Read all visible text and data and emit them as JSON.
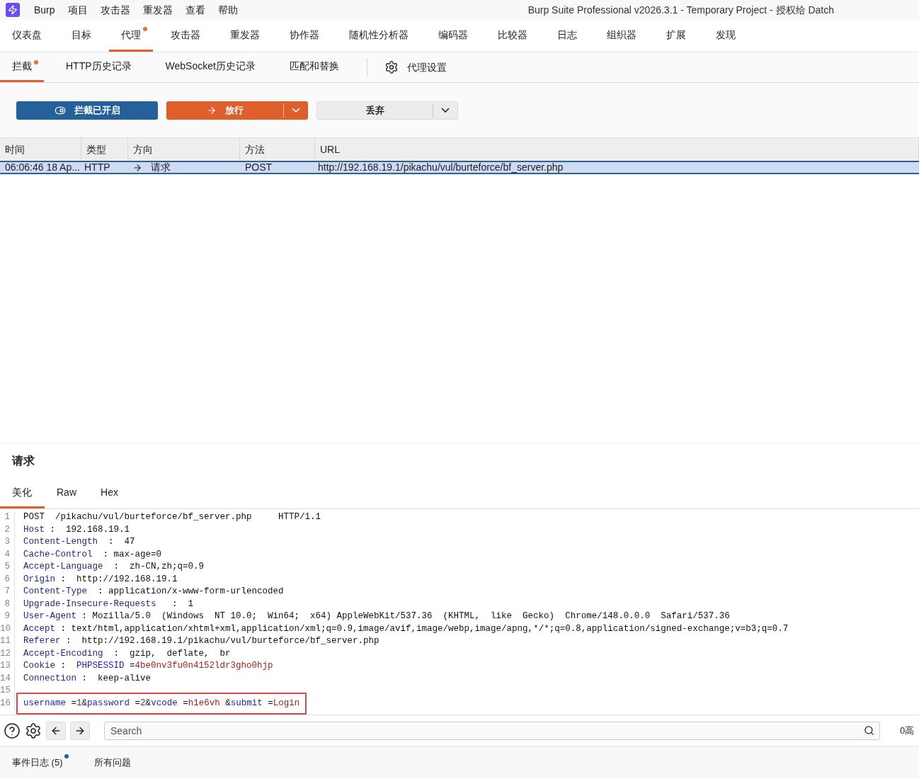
{
  "menu_bar": {
    "items": [
      "Burp",
      "项目",
      "攻击器",
      "重发器",
      "查看",
      "帮助"
    ],
    "title": "Burp Suite Professional v2026.3.1 - Temporary Project - 授权给 Datch"
  },
  "main_tabs": [
    {
      "label": "仪表盘",
      "selected": false,
      "dot": false
    },
    {
      "label": "目标",
      "selected": false,
      "dot": false
    },
    {
      "label": "代理",
      "selected": true,
      "dot": true
    },
    {
      "label": "攻击器",
      "selected": false,
      "dot": false
    },
    {
      "label": "重发器",
      "selected": false,
      "dot": false
    },
    {
      "label": "协作器",
      "selected": false,
      "dot": false
    },
    {
      "label": "随机性分析器",
      "selected": false,
      "dot": false
    },
    {
      "label": "编码器",
      "selected": false,
      "dot": false
    },
    {
      "label": "比较器",
      "selected": false,
      "dot": false
    },
    {
      "label": "日志",
      "selected": false,
      "dot": false
    },
    {
      "label": "组织器",
      "selected": false,
      "dot": false
    },
    {
      "label": "扩展",
      "selected": false,
      "dot": false
    },
    {
      "label": "发现",
      "selected": false,
      "dot": false
    }
  ],
  "sub_tabs": [
    {
      "label": "拦截",
      "selected": true,
      "dot": true
    },
    {
      "label": "HTTP历史记录",
      "selected": false,
      "dot": false
    },
    {
      "label": "WebSocket历史记录",
      "selected": false,
      "dot": false
    },
    {
      "label": "匹配和替换",
      "selected": false,
      "dot": false
    }
  ],
  "settings_tab": "代理设置",
  "toolbar": {
    "intercept": {
      "label": "拦截已开启",
      "on": true
    },
    "forward": "放行",
    "drop": "丢弃"
  },
  "table": {
    "columns": [
      "时间",
      "类型",
      "方向",
      "方法",
      "URL"
    ],
    "rows": [
      {
        "time": "06:06:46 18 Ap...",
        "type": "HTTP",
        "direction": "请求",
        "method": "POST",
        "url": "http://192.168.19.1/pikachu/vul/burteforce/bf_server.php",
        "selected": true
      }
    ]
  },
  "request": {
    "title": "请求",
    "tabs": [
      {
        "label": "美化",
        "selected": true
      },
      {
        "label": "Raw",
        "selected": false
      },
      {
        "label": "Hex",
        "selected": false
      }
    ],
    "lines": [
      {
        "number": "1",
        "highlighted": false,
        "tokens": [
          {
            "kind": "plain",
            "text": "POST  /pikachu/vul/burteforce/bf_server.php     HTTP/1.1"
          }
        ]
      },
      {
        "number": "2",
        "highlighted": false,
        "tokens": [
          {
            "kind": "key",
            "text": "Host"
          },
          {
            "kind": "plain",
            "text": " :  192.168.19.1"
          }
        ]
      },
      {
        "number": "3",
        "highlighted": false,
        "tokens": [
          {
            "kind": "key",
            "text": "Content-Length"
          },
          {
            "kind": "plain",
            "text": "  :  47"
          }
        ]
      },
      {
        "number": "4",
        "highlighted": false,
        "tokens": [
          {
            "kind": "key",
            "text": "Cache-Control"
          },
          {
            "kind": "plain",
            "text": "  : max-age=0"
          }
        ]
      },
      {
        "number": "5",
        "highlighted": false,
        "tokens": [
          {
            "kind": "key",
            "text": "Accept-Language"
          },
          {
            "kind": "plain",
            "text": "  :  zh-CN,zh;q=0.9"
          }
        ]
      },
      {
        "number": "6",
        "highlighted": false,
        "tokens": [
          {
            "kind": "key",
            "text": "Origin"
          },
          {
            "kind": "plain",
            "text": " :  http://192.168.19.1"
          }
        ]
      },
      {
        "number": "7",
        "highlighted": false,
        "tokens": [
          {
            "kind": "key",
            "text": "Content-Type"
          },
          {
            "kind": "plain",
            "text": "  : application/x-www-form-urlencoded"
          }
        ]
      },
      {
        "number": "8",
        "highlighted": false,
        "tokens": [
          {
            "kind": "key",
            "text": "Upgrade-Insecure-Requests"
          },
          {
            "kind": "plain",
            "text": "   :  1"
          }
        ]
      },
      {
        "number": "9",
        "highlighted": false,
        "tokens": [
          {
            "kind": "key",
            "text": "User-Agent"
          },
          {
            "kind": "plain",
            "text": " : Mozilla/5.0  (Windows  NT 10.0;  Win64;  x64) AppleWebKit/537.36  (KHTML,  like  Gecko)  Chrome/148.0.0.0  Safari/537.36"
          }
        ]
      },
      {
        "number": "10",
        "highlighted": false,
        "tokens": [
          {
            "kind": "key",
            "text": "Accept"
          },
          {
            "kind": "plain",
            "text": " : text/html,application/xhtml+xml,application/xml;q=0.9,image/avif,image/webp,image/apng,*/*;q=0.8,application/signed-exchange;v=b3;q=0.7"
          }
        ]
      },
      {
        "number": "11",
        "highlighted": false,
        "tokens": [
          {
            "kind": "key",
            "text": "Referer"
          },
          {
            "kind": "plain",
            "text": " :  http://192.168.19.1/pikachu/vul/burteforce/bf_server.php"
          }
        ]
      },
      {
        "number": "12",
        "highlighted": false,
        "tokens": [
          {
            "kind": "key",
            "text": "Accept-Encoding"
          },
          {
            "kind": "plain",
            "text": "  :  gzip,  deflate,  br"
          }
        ]
      },
      {
        "number": "13",
        "highlighted": false,
        "tokens": [
          {
            "kind": "key",
            "text": "Cookie"
          },
          {
            "kind": "plain",
            "text": " :  "
          },
          {
            "kind": "param",
            "text": "PHPSESSID"
          },
          {
            "kind": "plain",
            "text": " ="
          },
          {
            "kind": "value",
            "text": "4be0nv3fu0n4152ldr3gho0hjp"
          }
        ]
      },
      {
        "number": "14",
        "highlighted": false,
        "tokens": [
          {
            "kind": "key",
            "text": "Connection"
          },
          {
            "kind": "plain",
            "text": " :  keep-alive"
          }
        ]
      },
      {
        "number": "15"
      },
      {
        "number": "16",
        "highlighted": true,
        "tokens": [
          {
            "kind": "param",
            "text": "username"
          },
          {
            "kind": "plain",
            "text": " ="
          },
          {
            "kind": "value",
            "text": "1"
          },
          {
            "kind": "plain",
            "text": "&"
          },
          {
            "kind": "param",
            "text": "password"
          },
          {
            "kind": "plain",
            "text": " ="
          },
          {
            "kind": "value",
            "text": "2"
          },
          {
            "kind": "plain",
            "text": "&"
          },
          {
            "kind": "param",
            "text": "vcode"
          },
          {
            "kind": "plain",
            "text": " ="
          },
          {
            "kind": "value",
            "text": "h1e6vh"
          },
          {
            "kind": "plain",
            "text": " &"
          },
          {
            "kind": "param",
            "text": "submit"
          },
          {
            "kind": "plain",
            "text": " ="
          },
          {
            "kind": "value",
            "text": "Login"
          }
        ]
      }
    ]
  },
  "search": {
    "placeholder": "Search",
    "highlights": "0高"
  },
  "status_tabs": [
    {
      "label": "事件日志 (5)",
      "dot": true
    },
    {
      "label": "所有问题",
      "dot": false
    }
  ]
}
